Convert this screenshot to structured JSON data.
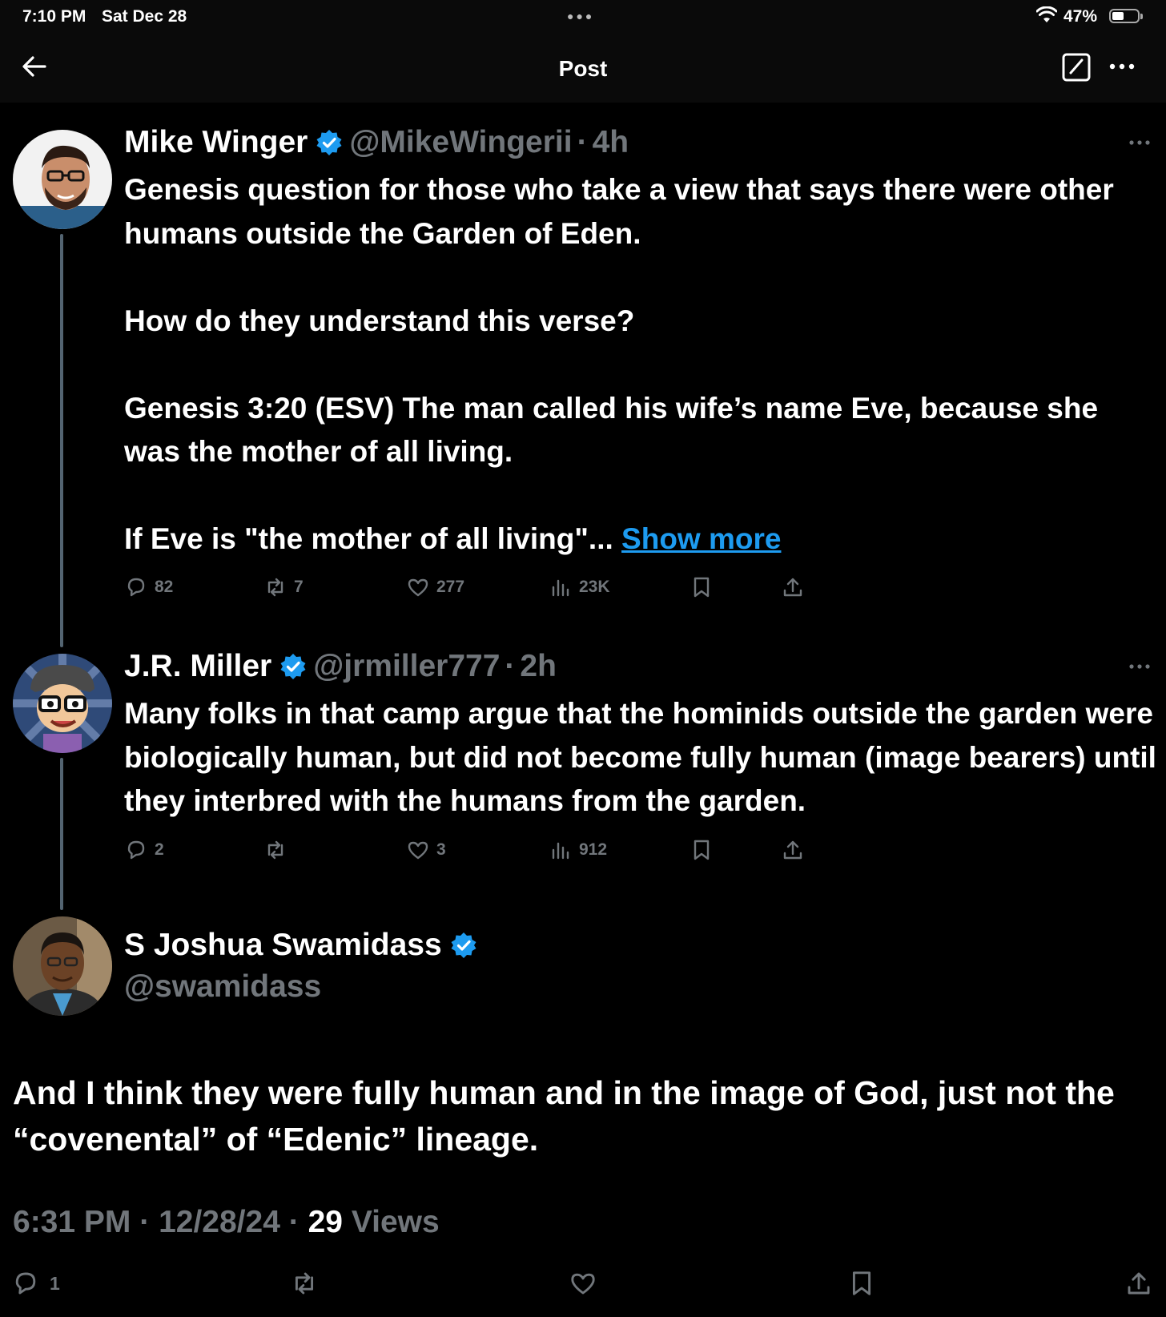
{
  "status_bar": {
    "time": "7:10 PM",
    "date": "Sat Dec 28",
    "battery": "47%",
    "battery_level": 0.47
  },
  "nav": {
    "title": "Post"
  },
  "thread": [
    {
      "name": "Mike Winger",
      "handle": "@MikeWingerii",
      "separator": "·",
      "age": "4h",
      "paragraphs": [
        "Genesis question for those who take a view that says there were other humans outside the Garden of Eden.",
        "How do they understand this verse?",
        "Genesis 3:20 (ESV) The man called his wife’s name Eve, because she was the mother of all living."
      ],
      "truncated_text": "If Eve is \"the mother of all living\"...",
      "show_more": "Show more",
      "stats": {
        "replies": "82",
        "reposts": "7",
        "likes": "277",
        "views": "23K"
      }
    },
    {
      "name": "J.R. Miller",
      "handle": "@jrmiller777",
      "separator": "·",
      "age": "2h",
      "paragraphs": [
        "Many folks in that camp argue that the hominids outside the garden were biologically human, but did not become fully human (image bearers) until they interbred with the humans from the garden."
      ],
      "stats": {
        "replies": "2",
        "reposts": "",
        "likes": "3",
        "views": "912"
      }
    }
  ],
  "main_post": {
    "name": "S Joshua Swamidass",
    "handle": "@swamidass",
    "text": "And I think they were fully human and in the image of God, just not the “covenental” of “Edenic” lineage.",
    "time": "6:31 PM",
    "sep1": "·",
    "date": "12/28/24",
    "sep2": "·",
    "views_count": "29",
    "views_label": "Views",
    "replies": "1"
  },
  "colors": {
    "background": "#000000",
    "link": "#1d9bf0",
    "verified": "#1d9bf0",
    "muted": "#71767b",
    "thread_line": "#536471"
  }
}
